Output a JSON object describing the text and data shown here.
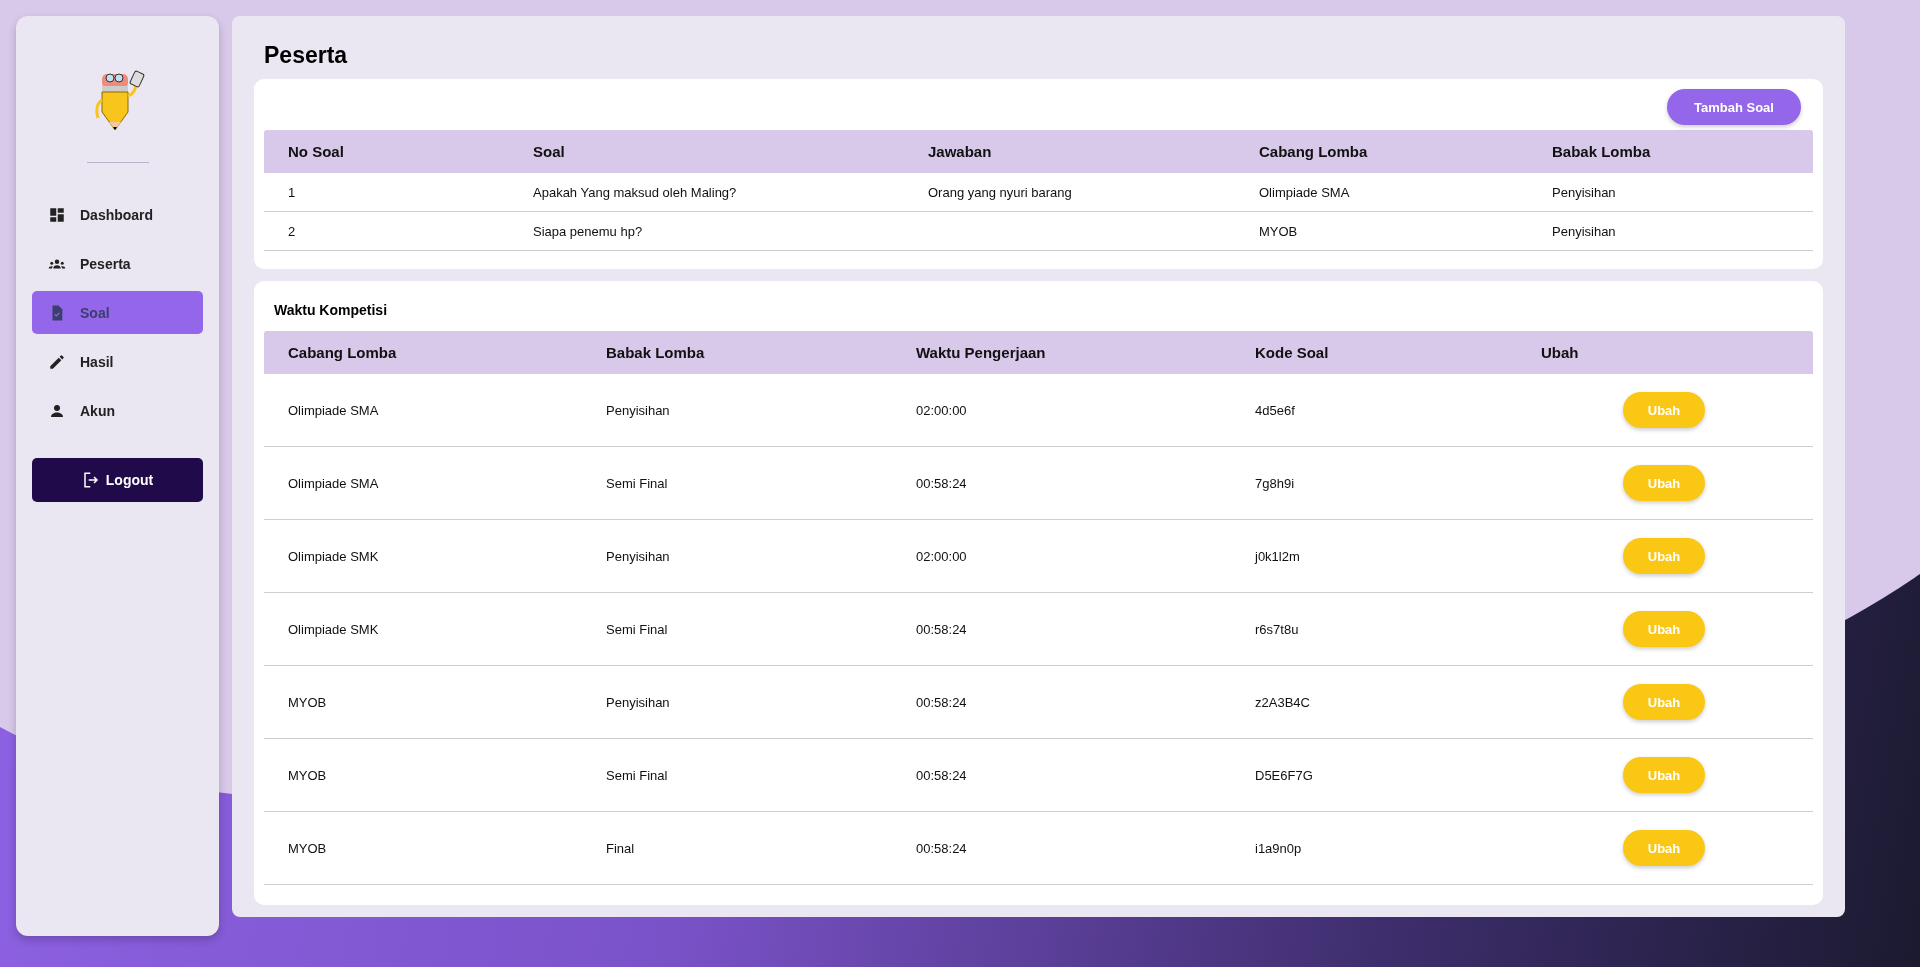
{
  "sidebar": {
    "items": [
      {
        "label": "Dashboard",
        "selected": false
      },
      {
        "label": "Peserta",
        "selected": false
      },
      {
        "label": "Soal",
        "selected": true
      },
      {
        "label": "Hasil",
        "selected": false
      },
      {
        "label": "Akun",
        "selected": false
      }
    ],
    "logout": "Logout"
  },
  "page_title": "Peserta",
  "questions": {
    "add_button": "Tambah Soal",
    "columns": [
      "No Soal",
      "Soal",
      "Jawaban",
      "Cabang Lomba",
      "Babak Lomba"
    ],
    "rows": [
      [
        "1",
        "Apakah Yang maksud oleh Maling?",
        "Orang yang nyuri barang",
        "Olimpiade SMA",
        "Penyisihan"
      ],
      [
        "2",
        "Siapa penemu hp?",
        "",
        "MYOB",
        "Penyisihan"
      ]
    ]
  },
  "competition_time": {
    "title": "Waktu Kompetisi",
    "columns": [
      "Cabang Lomba",
      "Babak Lomba",
      "Waktu Pengerjaan",
      "Kode Soal",
      "Ubah"
    ],
    "rows": [
      {
        "branch": "Olimpiade SMA",
        "round": "Penyisihan",
        "duration": "02:00:00",
        "code": "4d5e6f",
        "action": "Ubah"
      },
      {
        "branch": "Olimpiade SMA",
        "round": "Semi Final",
        "duration": "00:58:24",
        "code": "7g8h9i",
        "action": "Ubah"
      },
      {
        "branch": "Olimpiade SMK",
        "round": "Penyisihan",
        "duration": "02:00:00",
        "code": "j0k1l2m",
        "action": "Ubah"
      },
      {
        "branch": "Olimpiade SMK",
        "round": "Semi Final",
        "duration": "00:58:24",
        "code": "r6s7t8u",
        "action": "Ubah"
      },
      {
        "branch": "MYOB",
        "round": "Penyisihan",
        "duration": "00:58:24",
        "code": "z2A3B4C",
        "action": "Ubah"
      },
      {
        "branch": "MYOB",
        "round": "Semi Final",
        "duration": "00:58:24",
        "code": "D5E6F7G",
        "action": "Ubah"
      },
      {
        "branch": "MYOB",
        "round": "Final",
        "duration": "00:58:24",
        "code": "i1a9n0p",
        "action": "Ubah"
      }
    ]
  }
}
